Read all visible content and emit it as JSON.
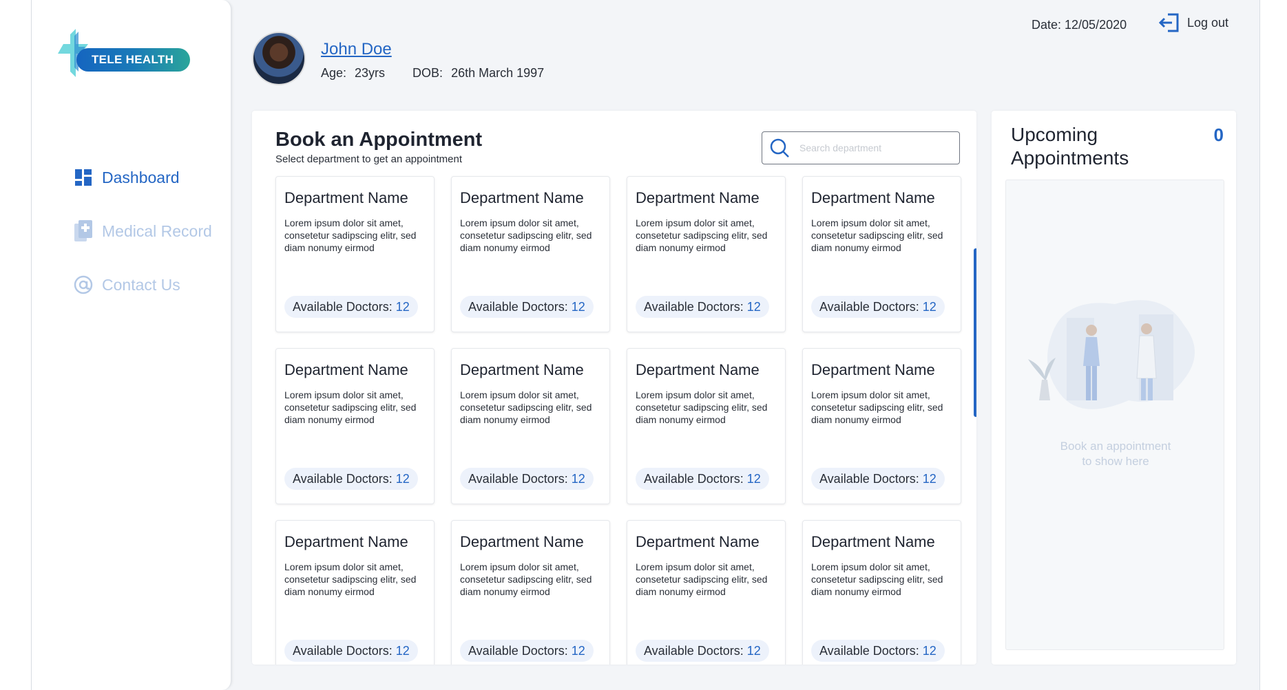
{
  "app": {
    "logo_text": "TELE HEALTH"
  },
  "sidebar": {
    "items": [
      {
        "label": "Dashboard",
        "icon": "dashboard-icon",
        "state": "active"
      },
      {
        "label": "Medical Record",
        "icon": "medical-record-icon",
        "state": "muted"
      },
      {
        "label": "Contact Us",
        "icon": "at-icon",
        "state": "muted"
      }
    ]
  },
  "header": {
    "name": "John Doe",
    "age_label": "Age:",
    "age_value": "23yrs",
    "dob_label": "DOB:",
    "dob_value": "26th March 1997",
    "date_text": "Date: 12/05/2020",
    "logout_label": "Log out"
  },
  "main": {
    "title": "Book an Appointment",
    "subtitle": "Select department to get an appointment",
    "search_placeholder": "Search department",
    "cards": [
      {
        "title": "Department Name",
        "desc": "Lorem ipsum dolor sit amet, consetetur sadipscing elitr, sed diam nonumy eirmod",
        "doctors_label": "Available Doctors:",
        "doctors_count": "12"
      },
      {
        "title": "Department Name",
        "desc": "Lorem ipsum dolor sit amet, consetetur sadipscing elitr, sed diam nonumy eirmod",
        "doctors_label": "Available Doctors:",
        "doctors_count": "12"
      },
      {
        "title": "Department Name",
        "desc": "Lorem ipsum dolor sit amet, consetetur sadipscing elitr, sed diam nonumy eirmod",
        "doctors_label": "Available Doctors:",
        "doctors_count": "12"
      },
      {
        "title": "Department Name",
        "desc": "Lorem ipsum dolor sit amet, consetetur sadipscing elitr, sed diam nonumy eirmod",
        "doctors_label": "Available Doctors:",
        "doctors_count": "12"
      },
      {
        "title": "Department Name",
        "desc": "Lorem ipsum dolor sit amet, consetetur sadipscing elitr, sed diam nonumy eirmod",
        "doctors_label": "Available Doctors:",
        "doctors_count": "12"
      },
      {
        "title": "Department Name",
        "desc": "Lorem ipsum dolor sit amet, consetetur sadipscing elitr, sed diam nonumy eirmod",
        "doctors_label": "Available Doctors:",
        "doctors_count": "12"
      },
      {
        "title": "Department Name",
        "desc": "Lorem ipsum dolor sit amet, consetetur sadipscing elitr, sed diam nonumy eirmod",
        "doctors_label": "Available Doctors:",
        "doctors_count": "12"
      },
      {
        "title": "Department Name",
        "desc": "Lorem ipsum dolor sit amet, consetetur sadipscing elitr, sed diam nonumy eirmod",
        "doctors_label": "Available Doctors:",
        "doctors_count": "12"
      },
      {
        "title": "Department Name",
        "desc": "Lorem ipsum dolor sit amet, consetetur sadipscing elitr, sed diam nonumy eirmod",
        "doctors_label": "Available Doctors:",
        "doctors_count": "12"
      },
      {
        "title": "Department Name",
        "desc": "Lorem ipsum dolor sit amet, consetetur sadipscing elitr, sed diam nonumy eirmod",
        "doctors_label": "Available Doctors:",
        "doctors_count": "12"
      },
      {
        "title": "Department Name",
        "desc": "Lorem ipsum dolor sit amet, consetetur sadipscing elitr, sed diam nonumy eirmod",
        "doctors_label": "Available Doctors:",
        "doctors_count": "12"
      },
      {
        "title": "Department Name",
        "desc": "Lorem ipsum dolor sit amet, consetetur sadipscing elitr, sed diam nonumy eirmod",
        "doctors_label": "Available Doctors:",
        "doctors_count": "12"
      }
    ]
  },
  "upcoming": {
    "title": "Upcoming Appointments",
    "count": "0",
    "empty_line1": "Book an appointment",
    "empty_line2": "to show here"
  },
  "colors": {
    "accent": "#2466c4",
    "muted_nav": "#b3c8e6",
    "logo_teal": "#2aa59a"
  }
}
